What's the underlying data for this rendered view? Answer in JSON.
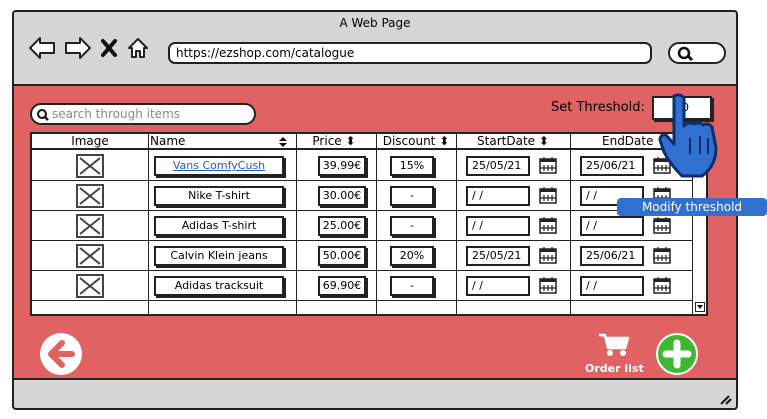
{
  "window": {
    "title": "A Web Page"
  },
  "browser": {
    "url": "https://ezshop.com/catalogue"
  },
  "search": {
    "placeholder": "search through items"
  },
  "threshold": {
    "label": "Set Threshold:",
    "value": "10",
    "tooltip": "Modify threshold"
  },
  "table": {
    "headers": {
      "image": "Image",
      "name": "Name",
      "price": "Price",
      "discount": "Discount",
      "start": "StartDate",
      "end": "EndDate"
    },
    "rows": [
      {
        "name": "Vans ComfyCush",
        "price": "39.99€",
        "discount": "15%",
        "start": "25/05/21",
        "end": "25/06/21"
      },
      {
        "name": "Nike T-shirt",
        "price": "30.00€",
        "discount": "-",
        "start": "/ /",
        "end": "/ /"
      },
      {
        "name": "Adidas T-shirt",
        "price": "25.00€",
        "discount": "-",
        "start": "/ /",
        "end": "/ /"
      },
      {
        "name": "Calvin Klein jeans",
        "price": "50.00€",
        "discount": "20%",
        "start": "25/05/21",
        "end": "25/06/21"
      },
      {
        "name": "Adidas tracksuit",
        "price": "69.90€",
        "discount": "-",
        "start": "/ /",
        "end": "/ /"
      }
    ]
  },
  "footer": {
    "order_list_label": "Order list"
  },
  "icons": {
    "back": "back-arrow-icon",
    "forward": "forward-arrow-icon",
    "stop": "stop-icon",
    "home": "home-icon",
    "search": "search-icon",
    "calendar": "calendar-icon",
    "cart": "cart-icon",
    "add": "add-icon",
    "image": "image-placeholder-icon",
    "pointer": "hand-pointer-icon"
  },
  "colors": {
    "content_bg": "#e06262",
    "link": "#1f5fb8",
    "tooltip": "#2f70d0",
    "add": "#3cb832"
  }
}
